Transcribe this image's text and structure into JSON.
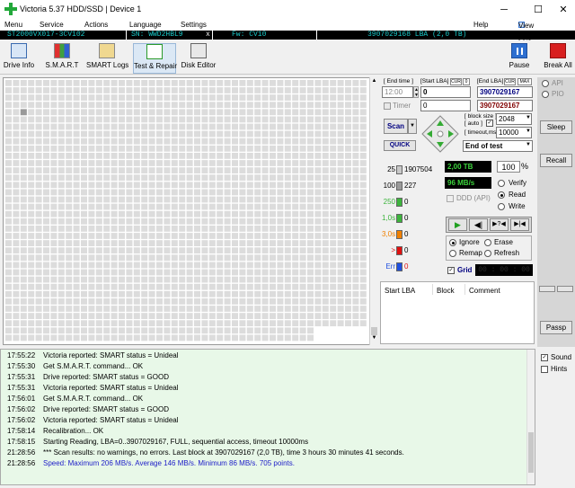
{
  "window": {
    "title": "Victoria 5.37 HDD/SSD | Device 1",
    "minimize": "─",
    "maximize": "☐",
    "close": "✕"
  },
  "menu": {
    "items": [
      "Menu",
      "Service",
      "Actions",
      "Language",
      "Settings",
      "Help"
    ],
    "view_buffer": "View Buffer Live"
  },
  "device_bar": {
    "model": "ST2000VX017-3CV102",
    "sn": "SN: WWD2HBL9",
    "x": "x",
    "fw": "Fw: CV10",
    "lba": "3907029168 LBA (2,0 TB)"
  },
  "toolbar": {
    "drive_info": "Drive Info",
    "smart": "S.M.A.R.T",
    "smart_logs": "SMART Logs",
    "test_repair": "Test & Repair",
    "disk_editor": "Disk Editor",
    "pause": "Pause",
    "break_all": "Break All"
  },
  "scan": {
    "end_time_label": "[ End time ]",
    "start_lba_label": "[Start LBA]",
    "cur": "CUR",
    "zero": "0",
    "end_lba_label": "[End LBA]",
    "cur2": "CUR",
    "max": "MAX",
    "time_value": "12:00",
    "start_lba": "0",
    "end_lba": "3907029167",
    "end_lba_2": "3907029167",
    "timer_label": "Timer",
    "timer_value": "0",
    "scan_btn": "Scan",
    "quick_btn": "QUICK",
    "block_size_label": "[ block size ]",
    "auto_label": "[ auto ]",
    "block_size": "2048",
    "timeout_label": "[ timeout,ms ]",
    "timeout": "10000",
    "end_of_test": "End of test"
  },
  "stats": [
    {
      "label": "25",
      "count": "1907504",
      "color": "#c8c8c8"
    },
    {
      "label": "100",
      "count": "227",
      "color": "#9a9a9a"
    },
    {
      "label": "250",
      "count": "0",
      "color": "#3cb43c"
    },
    {
      "label": "1,0s",
      "count": "0",
      "color": "#3cb43c"
    },
    {
      "label": "3,0s",
      "count": "0",
      "color": "#f08000"
    },
    {
      "label": ">",
      "count": "0",
      "color": "#e01010"
    },
    {
      "label": "Err",
      "count": "0",
      "color": "#2050e0"
    }
  ],
  "progress": {
    "size": "2,00 TB",
    "percent": "100",
    "percent_sign": "%",
    "speed": "96 MB/s",
    "ddd": "DDD (API)"
  },
  "modes": {
    "verify": "Verify",
    "read": "Read",
    "write": "Write"
  },
  "actions": {
    "ignore": "Ignore",
    "erase": "Erase",
    "remap": "Remap",
    "refresh": "Refresh",
    "grid": "Grid",
    "clock": "00 : 00 : 00"
  },
  "table": {
    "headers": [
      "Start LBA",
      "Block",
      "Comment"
    ]
  },
  "right_panel": {
    "api": "API",
    "pio": "PIO",
    "sleep": "Sleep",
    "recall": "Recall",
    "passp": "Passp",
    "sound": "Sound",
    "hints": "Hints"
  },
  "log": [
    {
      "time": "17:55:22",
      "msg": "Victoria reported: SMART status = Unideal",
      "color": "#000000"
    },
    {
      "time": "17:55:30",
      "msg": "Get S.M.A.R.T. command... OK",
      "color": "#000000"
    },
    {
      "time": "17:55:31",
      "msg": "Drive reported: SMART status = GOOD",
      "color": "#000000"
    },
    {
      "time": "17:55:31",
      "msg": "Victoria reported: SMART status = Unideal",
      "color": "#000000"
    },
    {
      "time": "17:56:01",
      "msg": "Get S.M.A.R.T. command... OK",
      "color": "#000000"
    },
    {
      "time": "17:56:02",
      "msg": "Drive reported: SMART status = GOOD",
      "color": "#000000"
    },
    {
      "time": "17:56:02",
      "msg": "Victoria reported: SMART status = Unideal",
      "color": "#000000"
    },
    {
      "time": "17:58:14",
      "msg": "Recalibration... OK",
      "color": "#000000"
    },
    {
      "time": "17:58:15",
      "msg": "Starting Reading, LBA=0..3907029167, FULL, sequential access, timeout 10000ms",
      "color": "#000000"
    },
    {
      "time": "21:28:56",
      "msg": "*** Scan results: no warnings, no errors. Last block at 3907029167 (2,0 TB), time 3 hours 30 minutes 41 seconds.",
      "color": "#000000"
    },
    {
      "time": "21:28:56",
      "msg": "Speed: Maximum 206 MB/s. Average 146 MB/s. Minimum 86 MB/s. 705 points.",
      "color": "#2020c8"
    }
  ]
}
